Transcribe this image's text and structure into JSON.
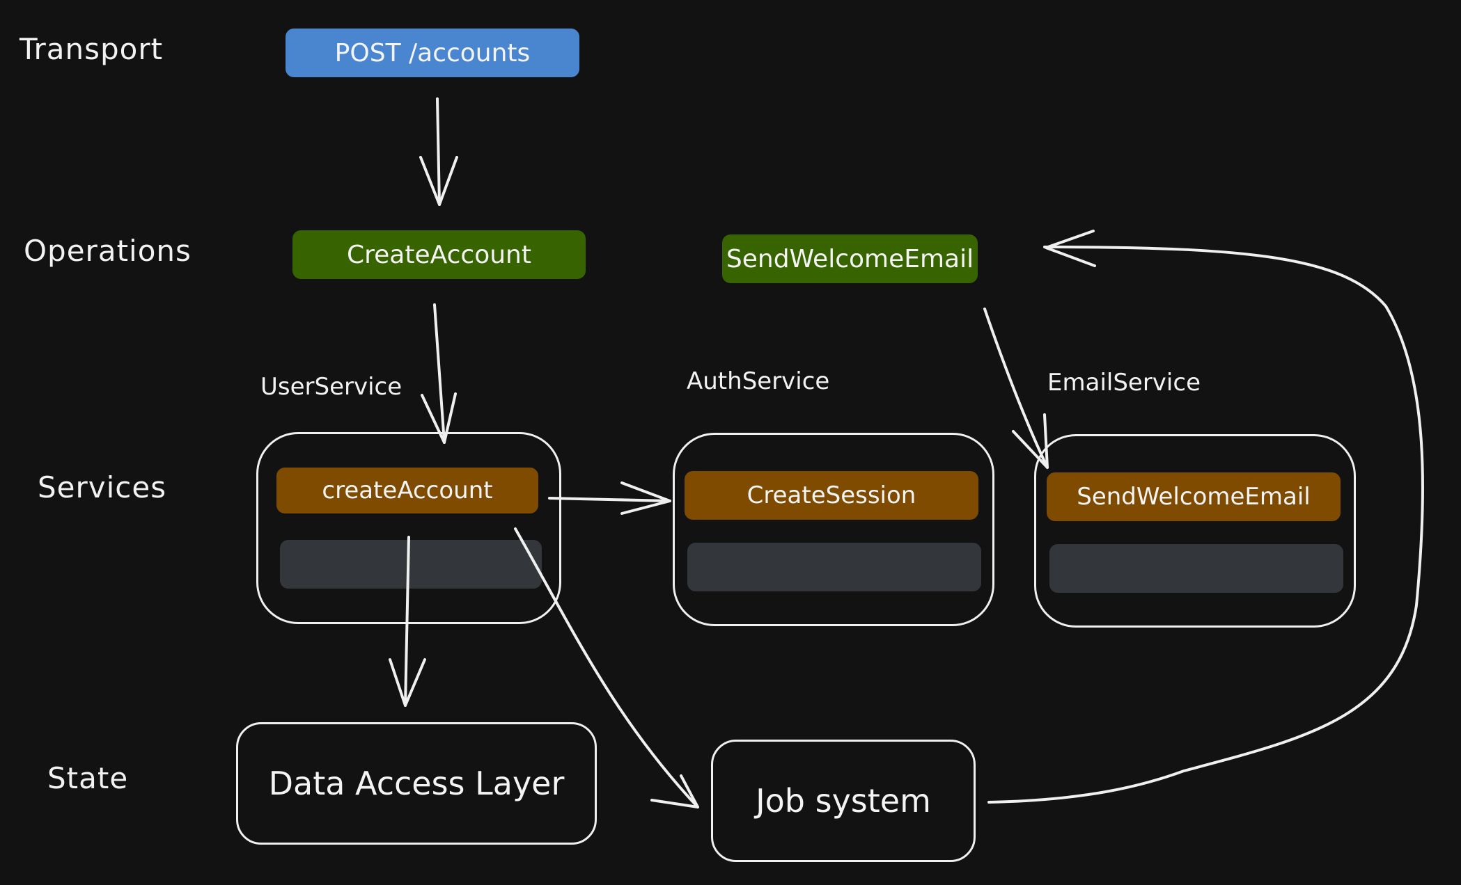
{
  "layers": {
    "transport": "Transport",
    "operations": "Operations",
    "services": "Services",
    "state": "State"
  },
  "transport": {
    "endpoint": "POST /accounts",
    "color": "#4a86d0"
  },
  "operations": {
    "color": "#386400",
    "items": [
      "CreateAccount",
      "SendWelcomeEmail"
    ]
  },
  "services": {
    "method_color": "#7e4b00",
    "items": [
      {
        "name": "UserService",
        "method": "createAccount"
      },
      {
        "name": "AuthService",
        "method": "CreateSession"
      },
      {
        "name": "EmailService",
        "method": "SendWelcomeEmail"
      }
    ]
  },
  "state": {
    "items": [
      "Data Access Layer",
      "Job system"
    ]
  },
  "edges": [
    {
      "from": "POST /accounts",
      "to": "CreateAccount"
    },
    {
      "from": "CreateAccount",
      "to": "UserService.createAccount"
    },
    {
      "from": "UserService.createAccount",
      "to": "AuthService.CreateSession"
    },
    {
      "from": "UserService.createAccount",
      "to": "Data Access Layer"
    },
    {
      "from": "UserService.createAccount",
      "to": "Job system"
    },
    {
      "from": "Job system",
      "to": "SendWelcomeEmail"
    },
    {
      "from": "SendWelcomeEmail",
      "to": "EmailService.SendWelcomeEmail"
    }
  ]
}
